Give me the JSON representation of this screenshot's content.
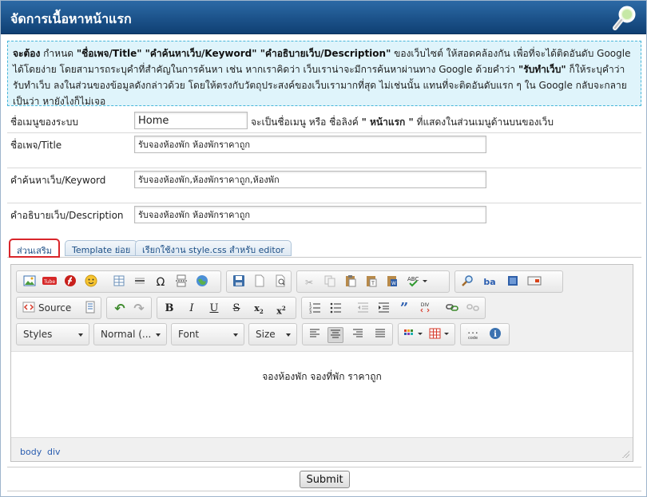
{
  "header": {
    "title": "จัดการเนื้อหาหน้าแรก",
    "icon": "magnifier-icon"
  },
  "notice": {
    "bold1": "จะต้อง",
    "t1": " กำหนด ",
    "bold2": "\"ชื่อเพจ/Title\" \"คำค้นหาเว็บ/Keyword\" \"คำอธิบายเว็บ/Description\"",
    "t2": " ของเว็บไซต์ ให้สอดคล้องกัน เพื่อที่จะได้ติดอันดับ Google ได้โดยง่าย โดยสามารถระบุคำที่สำคัญในการค้นหา เช่น หากเราคิดว่า เว็บเราน่าจะมีการค้นหาผ่านทาง Google ด้วยคำว่า ",
    "bold3": "\"รับทำเว็บ\"",
    "t3": " ก็ให้ระบุคำว่า รับทำเว็บ ลงในส่วนของข้อมูลดังกล่าวด้วย โดยให้ตรงกับวัตถุประสงค์ของเว็บเรามากที่สุด ไม่เช่นนั้น แทนที่จะติดอันดับแรก ๆ ใน Google กลับจะกลายเป็นว่า หายังไงก็ไม่เจอ"
  },
  "fields": {
    "menu_name": {
      "label": "ชื่อเมนูของระบบ",
      "value": "Home",
      "hint_pre": "จะเป็นชื่อเมนู หรือ ชื่อลิงค์ ",
      "hint_bold": "\" หน้าแรก \"",
      "hint_post": " ที่แสดงในส่วนเมนูด้านบนของเว็บ"
    },
    "title": {
      "label": "ชื่อเพจ/Title",
      "value": "รับจองห้องพัก ห้องพักราคาถูก"
    },
    "keyword": {
      "label": "คำค้นหาเว็บ/Keyword",
      "value": "รับจองห้องพัก,ห้องพักราคาถูก,ห้องพัก"
    },
    "description": {
      "label": "คำอธิบายเว็บ/Description",
      "value": "รับจองห้องพัก ห้องพักราคาถูก"
    }
  },
  "tabs": [
    {
      "label": "ส่วนเสริม"
    },
    {
      "label": "Template ย่อย"
    },
    {
      "label": "เรียกใช้งาน style.css สำหรับ editor"
    }
  ],
  "editor": {
    "source_label": "Source",
    "combos": {
      "styles": "Styles",
      "format": "Normal (...",
      "font": "Font",
      "size": "Size"
    },
    "content_text": "จองห้องพัก จองที่พัก ราคาถูก",
    "path": [
      "body",
      "div"
    ]
  },
  "submit_label": "Submit",
  "colors": {
    "header": "#1b528c",
    "notice_bg": "#dff4fb",
    "notice_border": "#47b6d9",
    "active_tab_border": "#d9262b"
  }
}
